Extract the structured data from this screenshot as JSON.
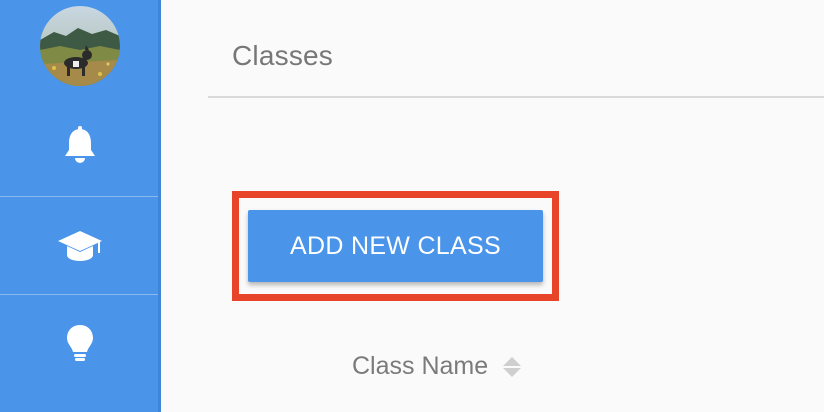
{
  "page": {
    "title": "Classes"
  },
  "actions": {
    "add_class_label": "ADD NEW CLASS"
  },
  "table": {
    "columns": [
      {
        "label": "Class Name",
        "sortable": true
      }
    ]
  },
  "sidebar": {
    "items": [
      {
        "icon": "bell-icon"
      },
      {
        "icon": "graduation-cap-icon"
      },
      {
        "icon": "lightbulb-icon"
      }
    ]
  },
  "colors": {
    "sidebar": "#4a94ea",
    "button": "#4a94ea",
    "highlight": "#e8442a",
    "text": "#777777"
  }
}
